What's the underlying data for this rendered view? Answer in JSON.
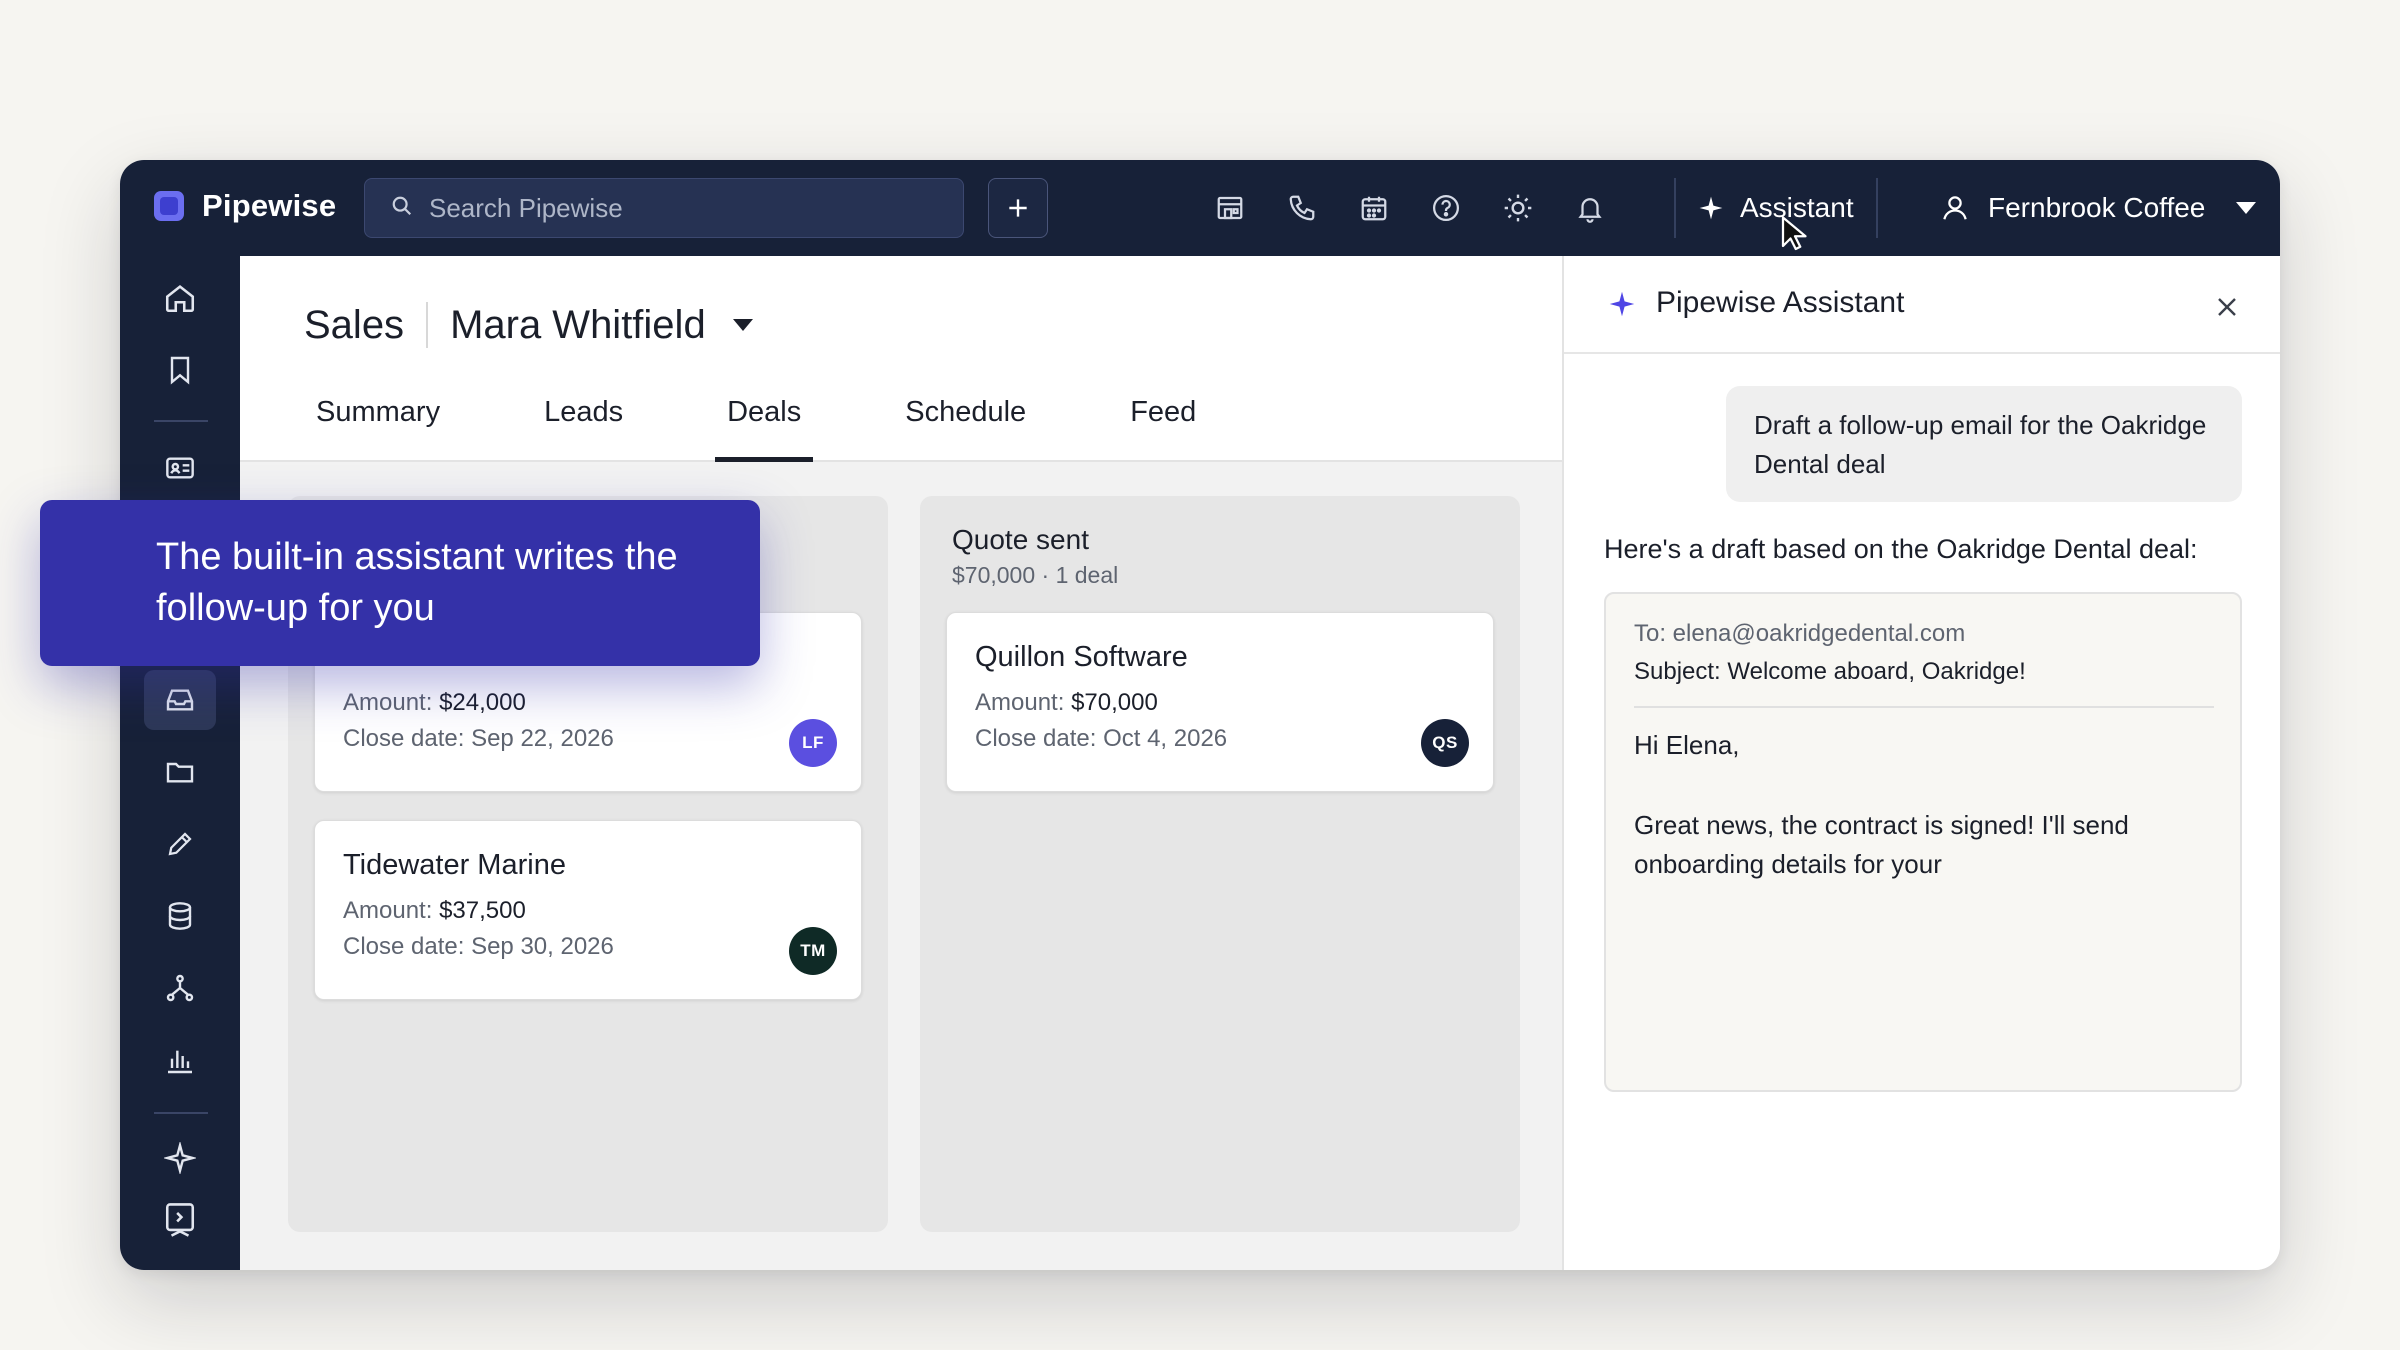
{
  "app": {
    "brand_name": "Pipewise",
    "search_placeholder": "Search Pipewise",
    "assistant_label": "Assistant",
    "org_name": "Fernbrook Coffee"
  },
  "page": {
    "section": "Sales",
    "owner": "Mara Whitfield",
    "tabs": [
      {
        "label": "Summary"
      },
      {
        "label": "Leads"
      },
      {
        "label": "Deals"
      },
      {
        "label": "Schedule"
      },
      {
        "label": "Feed"
      }
    ],
    "active_tab": "Deals"
  },
  "board": {
    "columns": [
      {
        "title": "",
        "subtitle": "",
        "cards": [
          {
            "title": "",
            "amount_label": "Amount:",
            "amount": "$24,000",
            "close_label": "Close date:",
            "close_date": "Sep 22, 2026",
            "avatar": "LF",
            "avatar_color": "#5b4fe0"
          },
          {
            "title": "Tidewater Marine",
            "amount_label": "Amount:",
            "amount": "$37,500",
            "close_label": "Close date:",
            "close_date": "Sep 30, 2026",
            "avatar": "TM",
            "avatar_color": "#0f2a26"
          }
        ]
      },
      {
        "title": "Quote sent",
        "subtitle": "$70,000 · 1 deal",
        "cards": [
          {
            "title": "Quillon Software",
            "amount_label": "Amount:",
            "amount": "$70,000",
            "close_label": "Close date:",
            "close_date": "Oct 4, 2026",
            "avatar": "QS",
            "avatar_color": "#172138"
          }
        ]
      }
    ]
  },
  "assistant_panel": {
    "title": "Pipewise Assistant",
    "user_message": "Draft a follow-up email for the Oakridge Dental deal",
    "reply_intro": "Here's a draft based on the Oakridge Dental deal:",
    "draft": {
      "to": "To: elena@oakridgedental.com",
      "subject": "Subject: Welcome aboard, Oakridge!",
      "greeting": "Hi Elena,",
      "body": "Great news, the contract is signed! I'll send onboarding details for your"
    }
  },
  "callout": {
    "text": "The built-in assistant writes the follow-up for you"
  },
  "colors": {
    "nav_bg": "#172138",
    "accent": "#3431a8",
    "brand": "#6b6ef0"
  }
}
